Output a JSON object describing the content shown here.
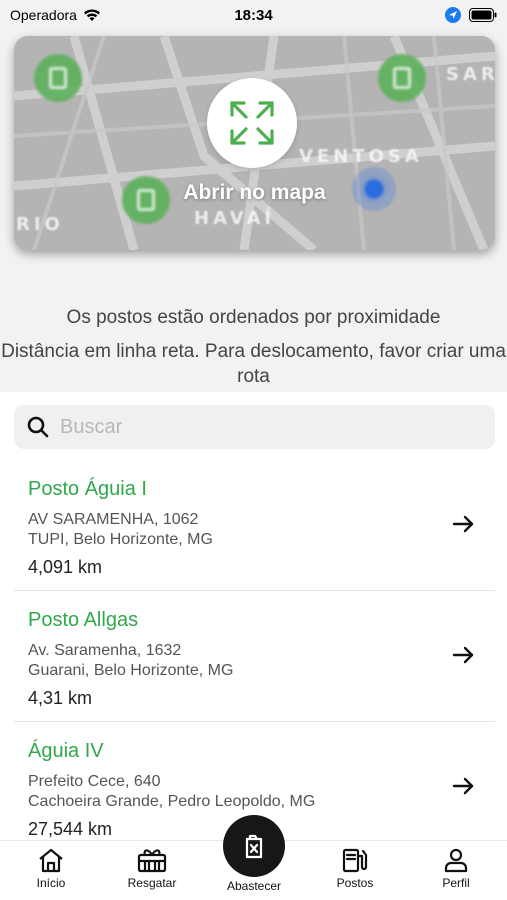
{
  "status": {
    "carrier": "Operadora",
    "time": "18:34"
  },
  "map": {
    "open_label": "Abrir no mapa",
    "streets": [
      "VENTOSA",
      "HAVAÍ",
      "RIO",
      "SAR"
    ]
  },
  "info": {
    "line1": "Os postos estão ordenados por proximidade",
    "line2": "Distância em linha reta. Para deslocamento, favor criar uma rota"
  },
  "search": {
    "placeholder": "Buscar",
    "value": ""
  },
  "stations": [
    {
      "name": "Posto Águia I",
      "address1": "AV SARAMENHA, 1062",
      "address2": "TUPI, Belo Horizonte, MG",
      "distance": "4,091 km"
    },
    {
      "name": "Posto Allgas",
      "address1": "Av. Saramenha, 1632",
      "address2": "Guarani, Belo Horizonte, MG",
      "distance": "4,31 km"
    },
    {
      "name": "Águia IV",
      "address1": "Prefeito Cece, 640",
      "address2": "Cachoeira Grande, Pedro Leopoldo, MG",
      "distance": "27,544 km"
    }
  ],
  "nav": {
    "home": "Início",
    "redeem": "Resgatar",
    "refuel": "Abastecer",
    "stations": "Postos",
    "profile": "Perfil"
  },
  "colors": {
    "accent": "#30a84a",
    "fab": "#171717",
    "location": "#2a6de0"
  }
}
